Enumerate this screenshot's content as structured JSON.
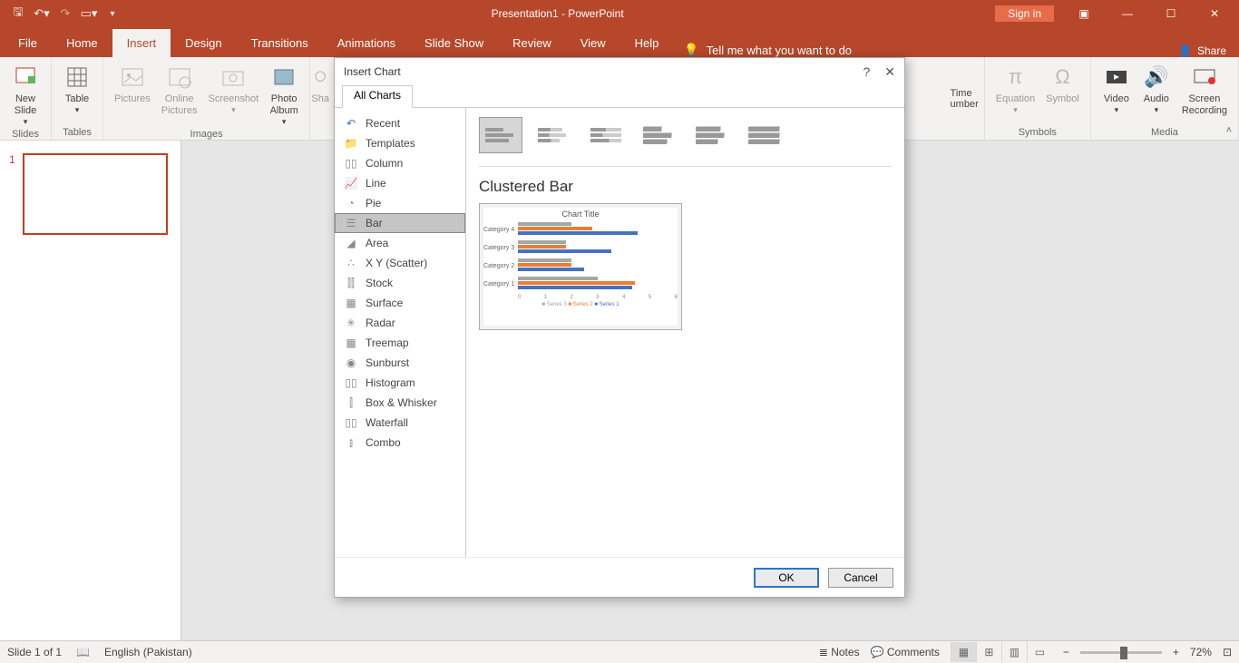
{
  "title": "Presentation1 - PowerPoint",
  "signin": "Sign in",
  "share": "Share",
  "tabs": [
    "File",
    "Home",
    "Insert",
    "Design",
    "Transitions",
    "Animations",
    "Slide Show",
    "Review",
    "View",
    "Help"
  ],
  "active_tab": "Insert",
  "tellme": "Tell me what you want to do",
  "ribbon": {
    "slides_group": "Slides",
    "new_slide": "New\nSlide",
    "tables_group": "Tables",
    "table": "Table",
    "images_group": "Images",
    "pictures": "Pictures",
    "online_pictures": "Online\nPictures",
    "screenshot": "Screenshot",
    "photo_album": "Photo\nAlbum",
    "sha": "Sha",
    "time": "Time",
    "number": "umber",
    "symbols_group": "Symbols",
    "equation": "Equation",
    "symbol": "Symbol",
    "media_group": "Media",
    "video": "Video",
    "audio": "Audio",
    "screen_rec": "Screen\nRecording"
  },
  "thumb_num": "1",
  "status": {
    "slide": "Slide 1 of 1",
    "lang": "English (Pakistan)",
    "notes": "Notes",
    "comments": "Comments",
    "zoom": "72%"
  },
  "dialog": {
    "title": "Insert Chart",
    "tab": "All Charts",
    "categories": [
      "Recent",
      "Templates",
      "Column",
      "Line",
      "Pie",
      "Bar",
      "Area",
      "X Y (Scatter)",
      "Stock",
      "Surface",
      "Radar",
      "Treemap",
      "Sunburst",
      "Histogram",
      "Box & Whisker",
      "Waterfall",
      "Combo"
    ],
    "selected_cat": "Bar",
    "preview_title": "Clustered Bar",
    "ok": "OK",
    "cancel": "Cancel",
    "help": "?",
    "close": "✕"
  },
  "chart_data": {
    "type": "bar",
    "title": "Chart Title",
    "orientation": "horizontal",
    "categories": [
      "Category 4",
      "Category 3",
      "Category 2",
      "Category 1"
    ],
    "series": [
      {
        "name": "Series 3",
        "color": "#a6a6a6",
        "values": [
          2.0,
          1.8,
          2.0,
          3.0
        ]
      },
      {
        "name": "Series 2",
        "color": "#ed7d31",
        "values": [
          2.8,
          1.8,
          2.0,
          4.4
        ]
      },
      {
        "name": "Series 1",
        "color": "#4472c4",
        "values": [
          4.5,
          3.5,
          2.5,
          4.3
        ]
      }
    ],
    "xlim": [
      0,
      6
    ],
    "xticks": [
      0,
      1,
      2,
      3,
      4,
      5,
      6
    ],
    "legend_position": "bottom"
  }
}
